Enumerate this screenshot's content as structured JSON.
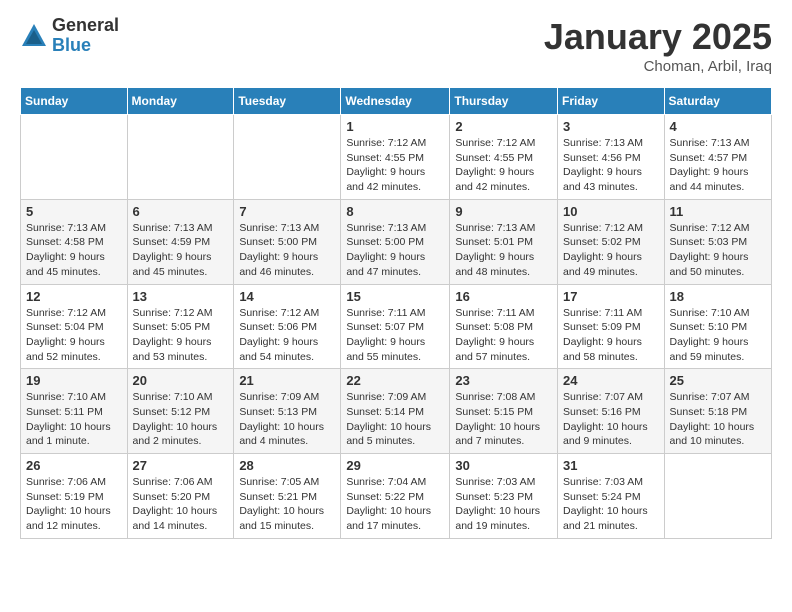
{
  "logo": {
    "general": "General",
    "blue": "Blue"
  },
  "title": "January 2025",
  "location": "Choman, Arbil, Iraq",
  "weekdays": [
    "Sunday",
    "Monday",
    "Tuesday",
    "Wednesday",
    "Thursday",
    "Friday",
    "Saturday"
  ],
  "weeks": [
    [
      {
        "day": "",
        "info": ""
      },
      {
        "day": "",
        "info": ""
      },
      {
        "day": "",
        "info": ""
      },
      {
        "day": "1",
        "info": "Sunrise: 7:12 AM\nSunset: 4:55 PM\nDaylight: 9 hours and 42 minutes."
      },
      {
        "day": "2",
        "info": "Sunrise: 7:12 AM\nSunset: 4:55 PM\nDaylight: 9 hours and 42 minutes."
      },
      {
        "day": "3",
        "info": "Sunrise: 7:13 AM\nSunset: 4:56 PM\nDaylight: 9 hours and 43 minutes."
      },
      {
        "day": "4",
        "info": "Sunrise: 7:13 AM\nSunset: 4:57 PM\nDaylight: 9 hours and 44 minutes."
      }
    ],
    [
      {
        "day": "5",
        "info": "Sunrise: 7:13 AM\nSunset: 4:58 PM\nDaylight: 9 hours and 45 minutes."
      },
      {
        "day": "6",
        "info": "Sunrise: 7:13 AM\nSunset: 4:59 PM\nDaylight: 9 hours and 45 minutes."
      },
      {
        "day": "7",
        "info": "Sunrise: 7:13 AM\nSunset: 5:00 PM\nDaylight: 9 hours and 46 minutes."
      },
      {
        "day": "8",
        "info": "Sunrise: 7:13 AM\nSunset: 5:00 PM\nDaylight: 9 hours and 47 minutes."
      },
      {
        "day": "9",
        "info": "Sunrise: 7:13 AM\nSunset: 5:01 PM\nDaylight: 9 hours and 48 minutes."
      },
      {
        "day": "10",
        "info": "Sunrise: 7:12 AM\nSunset: 5:02 PM\nDaylight: 9 hours and 49 minutes."
      },
      {
        "day": "11",
        "info": "Sunrise: 7:12 AM\nSunset: 5:03 PM\nDaylight: 9 hours and 50 minutes."
      }
    ],
    [
      {
        "day": "12",
        "info": "Sunrise: 7:12 AM\nSunset: 5:04 PM\nDaylight: 9 hours and 52 minutes."
      },
      {
        "day": "13",
        "info": "Sunrise: 7:12 AM\nSunset: 5:05 PM\nDaylight: 9 hours and 53 minutes."
      },
      {
        "day": "14",
        "info": "Sunrise: 7:12 AM\nSunset: 5:06 PM\nDaylight: 9 hours and 54 minutes."
      },
      {
        "day": "15",
        "info": "Sunrise: 7:11 AM\nSunset: 5:07 PM\nDaylight: 9 hours and 55 minutes."
      },
      {
        "day": "16",
        "info": "Sunrise: 7:11 AM\nSunset: 5:08 PM\nDaylight: 9 hours and 57 minutes."
      },
      {
        "day": "17",
        "info": "Sunrise: 7:11 AM\nSunset: 5:09 PM\nDaylight: 9 hours and 58 minutes."
      },
      {
        "day": "18",
        "info": "Sunrise: 7:10 AM\nSunset: 5:10 PM\nDaylight: 9 hours and 59 minutes."
      }
    ],
    [
      {
        "day": "19",
        "info": "Sunrise: 7:10 AM\nSunset: 5:11 PM\nDaylight: 10 hours and 1 minute."
      },
      {
        "day": "20",
        "info": "Sunrise: 7:10 AM\nSunset: 5:12 PM\nDaylight: 10 hours and 2 minutes."
      },
      {
        "day": "21",
        "info": "Sunrise: 7:09 AM\nSunset: 5:13 PM\nDaylight: 10 hours and 4 minutes."
      },
      {
        "day": "22",
        "info": "Sunrise: 7:09 AM\nSunset: 5:14 PM\nDaylight: 10 hours and 5 minutes."
      },
      {
        "day": "23",
        "info": "Sunrise: 7:08 AM\nSunset: 5:15 PM\nDaylight: 10 hours and 7 minutes."
      },
      {
        "day": "24",
        "info": "Sunrise: 7:07 AM\nSunset: 5:16 PM\nDaylight: 10 hours and 9 minutes."
      },
      {
        "day": "25",
        "info": "Sunrise: 7:07 AM\nSunset: 5:18 PM\nDaylight: 10 hours and 10 minutes."
      }
    ],
    [
      {
        "day": "26",
        "info": "Sunrise: 7:06 AM\nSunset: 5:19 PM\nDaylight: 10 hours and 12 minutes."
      },
      {
        "day": "27",
        "info": "Sunrise: 7:06 AM\nSunset: 5:20 PM\nDaylight: 10 hours and 14 minutes."
      },
      {
        "day": "28",
        "info": "Sunrise: 7:05 AM\nSunset: 5:21 PM\nDaylight: 10 hours and 15 minutes."
      },
      {
        "day": "29",
        "info": "Sunrise: 7:04 AM\nSunset: 5:22 PM\nDaylight: 10 hours and 17 minutes."
      },
      {
        "day": "30",
        "info": "Sunrise: 7:03 AM\nSunset: 5:23 PM\nDaylight: 10 hours and 19 minutes."
      },
      {
        "day": "31",
        "info": "Sunrise: 7:03 AM\nSunset: 5:24 PM\nDaylight: 10 hours and 21 minutes."
      },
      {
        "day": "",
        "info": ""
      }
    ]
  ]
}
